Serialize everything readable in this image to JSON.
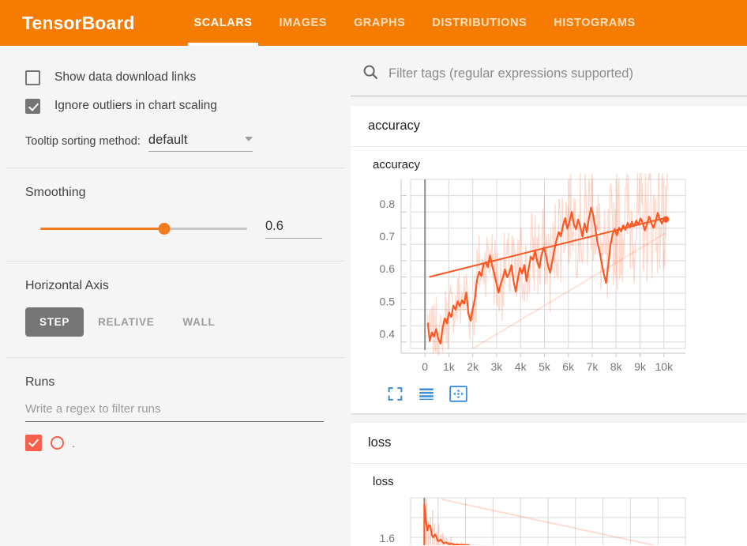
{
  "header": {
    "brand": "TensorBoard",
    "tabs": [
      {
        "label": "SCALARS",
        "active": true
      },
      {
        "label": "IMAGES",
        "active": false
      },
      {
        "label": "GRAPHS",
        "active": false
      },
      {
        "label": "DISTRIBUTIONS",
        "active": false
      },
      {
        "label": "HISTOGRAMS",
        "active": false
      }
    ],
    "bg_color": "#f57c00"
  },
  "sidebar": {
    "show_download_links": {
      "label": "Show data download links",
      "checked": false
    },
    "ignore_outliers": {
      "label": "Ignore outliers in chart scaling",
      "checked": true
    },
    "tooltip_sorting": {
      "label": "Tooltip sorting method:",
      "value": "default"
    },
    "smoothing": {
      "title": "Smoothing",
      "value": "0.6",
      "percent": 60
    },
    "horizontal_axis": {
      "title": "Horizontal Axis",
      "options": [
        {
          "label": "STEP",
          "active": true
        },
        {
          "label": "RELATIVE",
          "active": false
        },
        {
          "label": "WALL",
          "active": false
        }
      ]
    },
    "runs": {
      "title": "Runs",
      "filter_placeholder": "Write a regex to filter runs",
      "items": [
        {
          "name": ".",
          "checked": true,
          "color": "#f4604b"
        }
      ]
    }
  },
  "main": {
    "search": {
      "placeholder": "Filter tags (regular expressions supported)"
    },
    "cards": [
      {
        "header": "accuracy",
        "chart_title": "accuracy"
      },
      {
        "header": "loss",
        "chart_title": "loss"
      }
    ],
    "toolbar_icons": [
      "expand-chart-icon",
      "toggle-series-icon",
      "fit-domain-icon"
    ]
  },
  "chart_data": [
    {
      "type": "line",
      "title": "accuracy",
      "xlabel": "",
      "ylabel": "",
      "xlim": [
        -600,
        10900
      ],
      "ylim": [
        0.355,
        0.875
      ],
      "xticks": [
        0,
        1000,
        2000,
        3000,
        4000,
        5000,
        6000,
        7000,
        8000,
        9000,
        10000
      ],
      "xticklabels": [
        "0",
        "1k",
        "2k",
        "3k",
        "4k",
        "5k",
        "6k",
        "7k",
        "8k",
        "9k",
        "10k"
      ],
      "yticks": [
        0.4,
        0.5,
        0.6,
        0.7,
        0.8
      ],
      "yticklabels": [
        "0.4",
        "0.5",
        "0.6",
        "0.7",
        "0.8"
      ],
      "grid": true,
      "legend": "none",
      "series": [
        {
          "name": "smoothed",
          "color": "#ff5722",
          "opacity": 1,
          "width": 2.2,
          "x": [
            120,
            200,
            290,
            380,
            470,
            560,
            650,
            740,
            830,
            920,
            1010,
            1100,
            1190,
            1280,
            1370,
            1460,
            1550,
            1640,
            1730,
            1820,
            1910,
            2000,
            2090,
            2180,
            2270,
            2360,
            2450,
            2540,
            2630,
            2720,
            2810,
            2900,
            2990,
            3080,
            3170,
            3260,
            3350,
            3440,
            3530,
            3620,
            3710,
            3800,
            3890,
            3980,
            4070,
            4160,
            4250,
            4340,
            4430,
            4520,
            4610,
            4700,
            4790,
            4880,
            4970,
            5060,
            5150,
            5240,
            5330,
            5420,
            5510,
            5600,
            5690,
            5780,
            5870,
            5960,
            6050,
            6140,
            6230,
            6320,
            6410,
            6500,
            6590,
            6680,
            6770,
            6860,
            6950,
            7040,
            7130,
            7220,
            7310,
            7400,
            7490,
            7580,
            7670,
            7760,
            7850,
            7940,
            8030,
            8120,
            8210,
            8300,
            8390,
            8480,
            8570,
            8660,
            8750,
            8840,
            8930,
            9020,
            9110,
            9200,
            9290,
            9380,
            9470,
            9560,
            9650,
            9740,
            9830,
            9920,
            10010,
            10080
          ],
          "y": [
            0.432,
            0.378,
            0.404,
            0.392,
            0.415,
            0.385,
            0.37,
            0.418,
            0.447,
            0.432,
            0.466,
            0.452,
            0.487,
            0.474,
            0.5,
            0.485,
            0.503,
            0.493,
            0.527,
            0.462,
            0.44,
            0.478,
            0.508,
            0.566,
            0.591,
            0.578,
            0.613,
            0.62,
            0.605,
            0.641,
            0.61,
            0.585,
            0.556,
            0.527,
            0.553,
            0.572,
            0.598,
            0.574,
            0.588,
            0.611,
            0.562,
            0.53,
            0.571,
            0.603,
            0.585,
            0.612,
            0.562,
            0.601,
            0.637,
            0.628,
            0.654,
            0.622,
            0.603,
            0.641,
            0.665,
            0.642,
            0.61,
            0.588,
            0.623,
            0.661,
            0.69,
            0.713,
            0.7,
            0.735,
            0.756,
            0.723,
            0.745,
            0.775,
            0.737,
            0.722,
            0.751,
            0.73,
            0.699,
            0.74,
            0.712,
            0.754,
            0.788,
            0.765,
            0.726,
            0.681,
            0.652,
            0.616,
            0.583,
            0.557,
            0.61,
            0.672,
            0.706,
            0.722,
            0.703,
            0.726,
            0.715,
            0.733,
            0.72,
            0.741,
            0.728,
            0.744,
            0.731,
            0.748,
            0.736,
            0.755,
            0.742,
            0.718,
            0.737,
            0.76,
            0.742,
            0.726,
            0.745,
            0.772,
            0.751,
            0.739,
            0.757,
            0.752
          ]
        },
        {
          "name": "raw",
          "color": "#ff5722",
          "opacity": 0.22,
          "width": 1.3,
          "note": "unsmoothed noisy data, wide vertical excursions"
        },
        {
          "name": "trend",
          "color": "#ff5722",
          "opacity": 1,
          "width": 2,
          "x": [
            180,
            10080
          ],
          "y": [
            0.575,
            0.757
          ]
        },
        {
          "name": "faint-diagonal",
          "color": "#ff5722",
          "opacity": 0.17,
          "width": 2,
          "x": [
            2000,
            10080
          ],
          "y": [
            0.355,
            0.71
          ]
        }
      ],
      "marker": {
        "x": 10080,
        "y": 0.752,
        "color": "#ff5722",
        "radius": 4
      }
    },
    {
      "type": "line",
      "title": "loss",
      "grid": true,
      "yticklabels": [
        "1.6"
      ],
      "clipped": true,
      "series": [
        {
          "name": "loss-smoothed",
          "color": "#ff5722",
          "opacity": 1
        },
        {
          "name": "loss-raw",
          "color": "#ff5722",
          "opacity": 0.25
        },
        {
          "name": "loss-trend",
          "color": "#ff5722",
          "opacity": 0.2
        }
      ]
    }
  ]
}
